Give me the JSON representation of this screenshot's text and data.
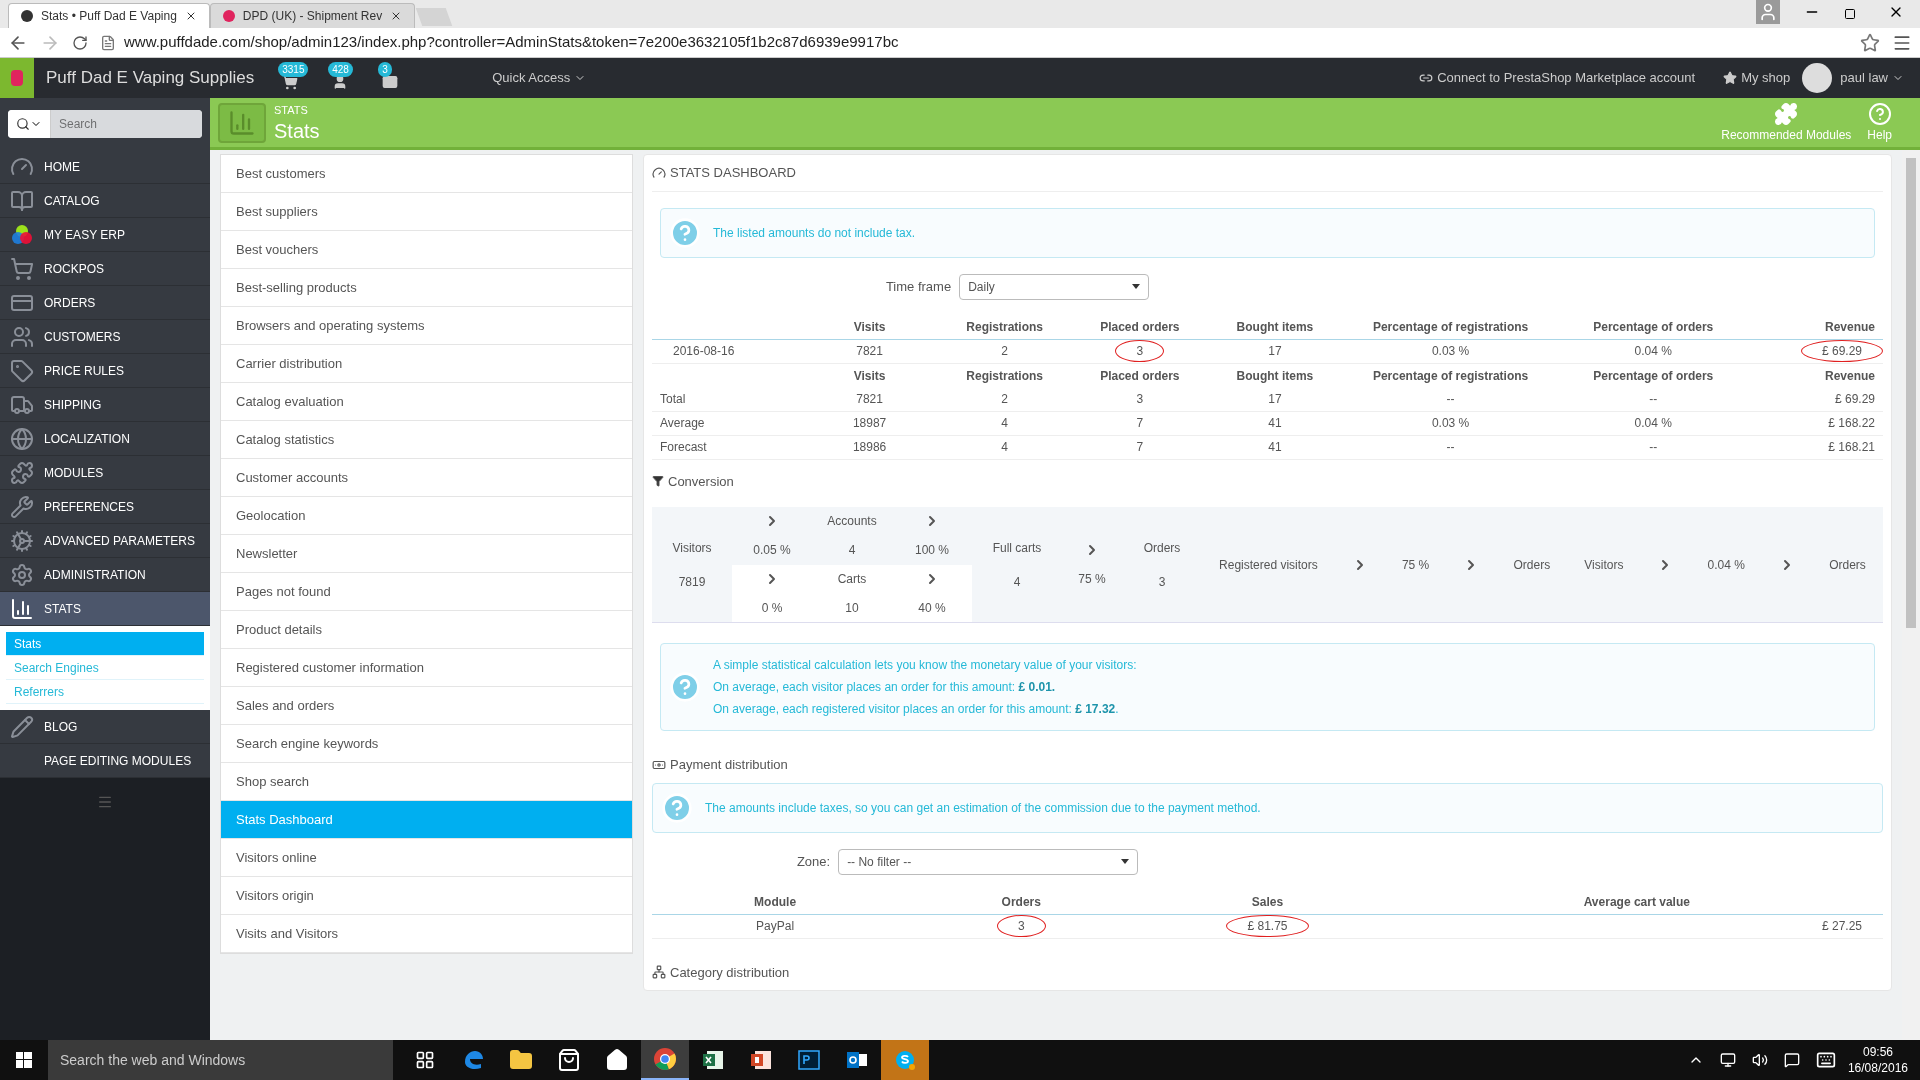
{
  "browser": {
    "tabs": [
      {
        "title": "Stats • Puff Dad E Vaping",
        "selected": true
      },
      {
        "title": "DPD (UK) - Shipment Rev",
        "selected": false
      }
    ],
    "url": "www.puffdade.com/shop/admin123/index.php?controller=AdminStats&token=7e200e3632105f1b2c87d6939e9917bc"
  },
  "header": {
    "shop_name": "Puff Dad E Vaping Supplies",
    "badges": [
      "3315",
      "428",
      "3"
    ],
    "quick_access": "Quick Access",
    "connect": "Connect to PrestaShop Marketplace account",
    "my_shop": "My shop",
    "user": "paul law"
  },
  "toolbar": {
    "breadcrumb": "STATS",
    "title": "Stats",
    "buttons": [
      "Recommended Modules",
      "Help"
    ]
  },
  "sidebar": {
    "search": {
      "placeholder": "Search"
    },
    "items": [
      {
        "label": "HOME",
        "selected": false
      },
      {
        "label": "CATALOG",
        "selected": false
      },
      {
        "label": "MY EASY ERP",
        "selected": false
      },
      {
        "label": "ROCKPOS",
        "selected": false
      },
      {
        "label": "ORDERS",
        "selected": false
      },
      {
        "label": "CUSTOMERS",
        "selected": false
      },
      {
        "label": "PRICE RULES",
        "selected": false
      },
      {
        "label": "SHIPPING",
        "selected": false
      },
      {
        "label": "LOCALIZATION",
        "selected": false
      },
      {
        "label": "MODULES",
        "selected": false
      },
      {
        "label": "PREFERENCES",
        "selected": false
      },
      {
        "label": "ADVANCED PARAMETERS",
        "selected": false
      },
      {
        "label": "ADMINISTRATION",
        "selected": false
      },
      {
        "label": "STATS",
        "selected": true,
        "children": [
          {
            "label": "Stats",
            "selected": true
          },
          {
            "label": "Search Engines",
            "selected": false
          },
          {
            "label": "Referrers",
            "selected": false
          }
        ]
      },
      {
        "label": "BLOG",
        "selected": false
      },
      {
        "label": "PAGE EDITING MODULES",
        "selected": false
      }
    ]
  },
  "stats_list": [
    {
      "label": "Best customers",
      "selected": false
    },
    {
      "label": "Best suppliers",
      "selected": false
    },
    {
      "label": "Best vouchers",
      "selected": false
    },
    {
      "label": "Best-selling products",
      "selected": false
    },
    {
      "label": "Browsers and operating systems",
      "selected": false
    },
    {
      "label": "Carrier distribution",
      "selected": false
    },
    {
      "label": "Catalog evaluation",
      "selected": false
    },
    {
      "label": "Catalog statistics",
      "selected": false
    },
    {
      "label": "Customer accounts",
      "selected": false
    },
    {
      "label": "Geolocation",
      "selected": false
    },
    {
      "label": "Newsletter",
      "selected": false
    },
    {
      "label": "Pages not found",
      "selected": false
    },
    {
      "label": "Product details",
      "selected": false
    },
    {
      "label": "Registered customer information",
      "selected": false
    },
    {
      "label": "Sales and orders",
      "selected": false
    },
    {
      "label": "Search engine keywords",
      "selected": false
    },
    {
      "label": "Shop search",
      "selected": false
    },
    {
      "label": "Stats Dashboard",
      "selected": true
    },
    {
      "label": "Visitors online",
      "selected": false
    },
    {
      "label": "Visitors origin",
      "selected": false
    },
    {
      "label": "Visits and Visitors",
      "selected": false
    }
  ],
  "dashboard": {
    "title": "STATS DASHBOARD",
    "notice": "The listed amounts do not include tax.",
    "time_frame": {
      "label": "Time frame",
      "value": "Daily"
    },
    "columns": [
      "Visits",
      "Registrations",
      "Placed orders",
      "Bought items",
      "Percentage of registrations",
      "Percentage of orders",
      "Revenue"
    ],
    "daily_rows": [
      [
        {
          "text": "2016-08-16",
          "circled": false
        },
        {
          "text": "7821",
          "circled": false
        },
        {
          "text": "2",
          "circled": false
        },
        {
          "text": "3",
          "circled": true
        },
        {
          "text": "17",
          "circled": false
        },
        {
          "text": "0.03 %",
          "circled": false
        },
        {
          "text": "0.04 %",
          "circled": false
        },
        {
          "text": "£ 69.29",
          "circled": true
        }
      ]
    ],
    "summary_columns": [
      "Visits",
      "Registrations",
      "Placed orders",
      "Bought items",
      "Percentage of registrations",
      "Percentage of orders",
      "Revenue"
    ],
    "summary_rows": [
      [
        "Total",
        "7821",
        "2",
        "3",
        "17",
        "--",
        "--",
        "£ 69.29"
      ],
      [
        "Average",
        "18987",
        "4",
        "7",
        "41",
        "0.03 %",
        "0.04 %",
        "£ 168.22"
      ],
      [
        "Forecast",
        "18986",
        "4",
        "7",
        "41",
        "--",
        "--",
        "£ 168.21"
      ]
    ]
  },
  "conversion": {
    "title": "Conversion",
    "visitors": {
      "label": "Visitors",
      "value": "7819"
    },
    "accounts": {
      "rate_in": "0.05 %",
      "label": "Accounts",
      "value": "4",
      "rate_out": "100 %"
    },
    "carts": {
      "rate_in": "0 %",
      "label": "Carts",
      "value": "10",
      "rate_out": "40 %"
    },
    "full_carts": {
      "label": "Full carts",
      "value": "4"
    },
    "full_rate": "75 %",
    "orders": {
      "label": "Orders",
      "value": "3"
    },
    "registered": {
      "from": "Registered visitors",
      "rate": "75 %",
      "to": "Orders"
    },
    "all": {
      "from": "Visitors",
      "rate": "0.04 %",
      "to": "Orders"
    }
  },
  "value_notice": [
    "A simple statistical calculation lets you know the monetary value of your visitors:",
    "On average, each visitor places an order for this amount: **£ 0.01.**",
    "On average, each registered visitor places an order for this amount: **£ 17.32**."
  ],
  "payment": {
    "title": "Payment distribution",
    "notice": "The amounts include taxes, so you can get an estimation of the commission due to the payment method.",
    "zone": {
      "label": "Zone:",
      "value": "-- No filter --"
    },
    "columns": [
      "Module",
      "Orders",
      "Sales",
      "Average cart value"
    ],
    "rows": [
      [
        {
          "text": "PayPal",
          "circled": false
        },
        {
          "text": "3",
          "circled": true
        },
        {
          "text": "£ 81.75",
          "circled": true
        },
        {
          "text": "£ 27.25",
          "circled": false
        }
      ]
    ]
  },
  "category": {
    "title": "Category distribution"
  },
  "taskbar": {
    "search_placeholder": "Search the web and Windows",
    "apps": [
      {
        "kind": "taskview",
        "selected": false
      },
      {
        "kind": "edge",
        "selected": false
      },
      {
        "kind": "folder",
        "selected": false
      },
      {
        "kind": "store",
        "selected": false
      },
      {
        "kind": "home",
        "selected": false
      },
      {
        "kind": "chrome",
        "selected": true
      },
      {
        "kind": "excel",
        "selected": false
      },
      {
        "kind": "powerpoint",
        "selected": false
      },
      {
        "kind": "photoshop",
        "selected": false
      },
      {
        "kind": "outlook",
        "selected": false
      },
      {
        "kind": "skype",
        "selected": false,
        "flashing": true
      }
    ],
    "time": "09:56",
    "date": "16/08/2016"
  }
}
